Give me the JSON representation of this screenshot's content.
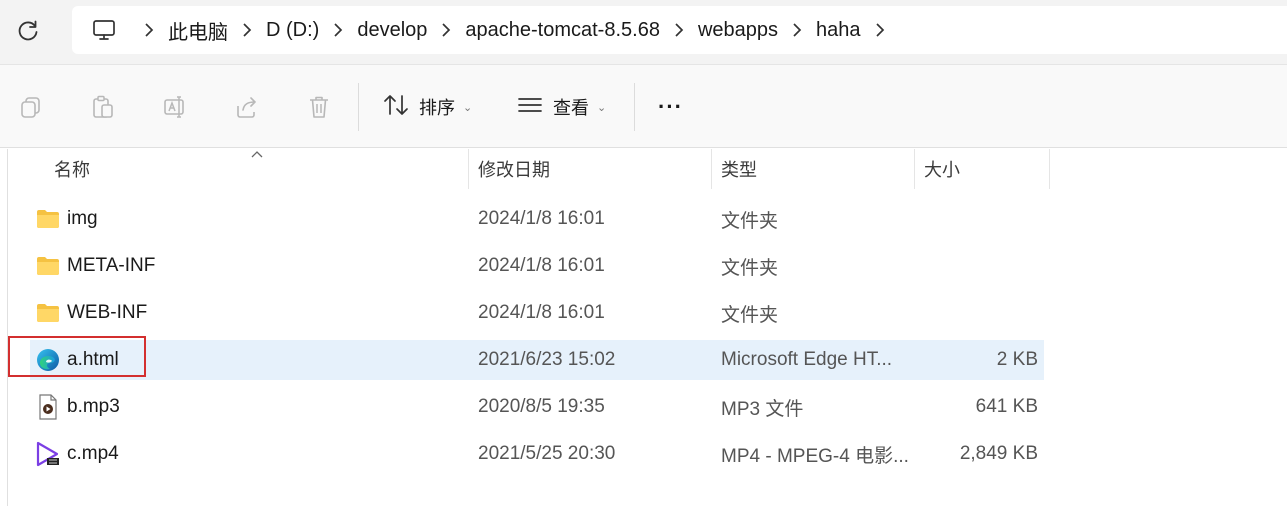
{
  "breadcrumb": [
    "此电脑",
    "D (D:)",
    "develop",
    "apache-tomcat-8.5.68",
    "webapps",
    "haha"
  ],
  "toolbar": {
    "icons": [
      "copy-icon",
      "paste-icon",
      "rename-icon",
      "share-icon",
      "delete-icon"
    ],
    "sort_label": "排序",
    "view_label": "查看",
    "more_label": "···"
  },
  "columns": {
    "name": "名称",
    "date": "修改日期",
    "type": "类型",
    "size": "大小"
  },
  "files": [
    {
      "name": "img",
      "date": "2024/1/8 16:01",
      "type": "文件夹",
      "size": "",
      "icon": "folder-icon"
    },
    {
      "name": "META-INF",
      "date": "2024/1/8 16:01",
      "type": "文件夹",
      "size": "",
      "icon": "folder-icon"
    },
    {
      "name": "WEB-INF",
      "date": "2024/1/8 16:01",
      "type": "文件夹",
      "size": "",
      "icon": "folder-icon"
    },
    {
      "name": "a.html",
      "date": "2021/6/23 15:02",
      "type": "Microsoft Edge HT...",
      "size": "2 KB",
      "icon": "edge-icon",
      "selected": true
    },
    {
      "name": "b.mp3",
      "date": "2020/8/5 19:35",
      "type": "MP3 文件",
      "size": "641 KB",
      "icon": "audio-file-icon"
    },
    {
      "name": "c.mp4",
      "date": "2021/5/25 20:30",
      "type": "MP4 - MPEG-4 电影...",
      "size": "2,849 KB",
      "icon": "video-file-icon"
    }
  ],
  "colors": {
    "selection": "#e6f1fb",
    "highlight_box": "#d32f2f",
    "folder": "#f5c242"
  }
}
